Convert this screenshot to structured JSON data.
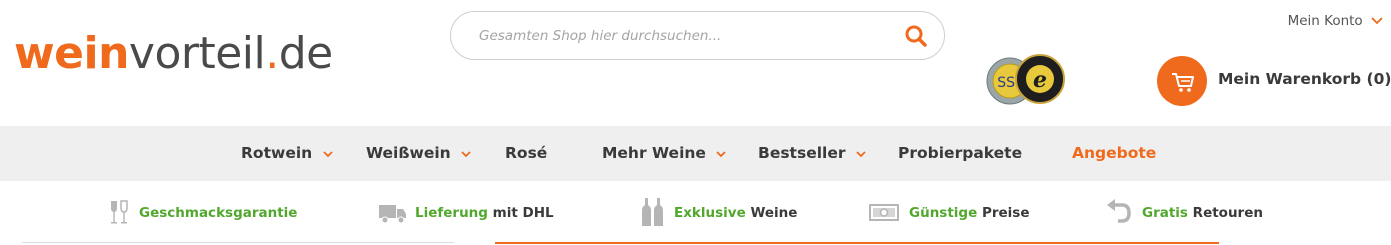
{
  "logo": {
    "part1": "wein",
    "part2": "vorteil",
    "part3": ".",
    "part4": "de"
  },
  "search": {
    "placeholder": "Gesamten Shop hier durchsuchen..."
  },
  "account": {
    "label": "Mein Konto"
  },
  "seals": {
    "ssl_label": "SSL",
    "trusted_label": "e"
  },
  "cart": {
    "label": "Mein Warenkorb (0)"
  },
  "nav": {
    "items": [
      {
        "label": "Rotwein",
        "has_dropdown": true
      },
      {
        "label": "Weißwein",
        "has_dropdown": true
      },
      {
        "label": "Rosé",
        "has_dropdown": false
      },
      {
        "label": "Mehr Weine",
        "has_dropdown": true
      },
      {
        "label": "Bestseller",
        "has_dropdown": true
      },
      {
        "label": "Probierpakete",
        "has_dropdown": false
      },
      {
        "label": "Angebote",
        "has_dropdown": false,
        "highlight": true
      }
    ]
  },
  "usp": {
    "items": [
      {
        "icon": "wine-glasses-icon",
        "green": "Geschmacksgarantie",
        "dark": ""
      },
      {
        "icon": "truck-icon",
        "green": "Lieferung",
        "dark": " mit DHL"
      },
      {
        "icon": "wine-bottles-icon",
        "green": "Exklusive",
        "dark": " Weine"
      },
      {
        "icon": "banknote-icon",
        "green": "Günstige",
        "dark": " Preise"
      },
      {
        "icon": "return-arrow-icon",
        "green": "Gratis",
        "dark": " Retouren"
      }
    ]
  },
  "colors": {
    "accent": "#ef6a1c",
    "green": "#52a82d",
    "nav_bg": "#efefef",
    "text": "#3a3a3a"
  }
}
